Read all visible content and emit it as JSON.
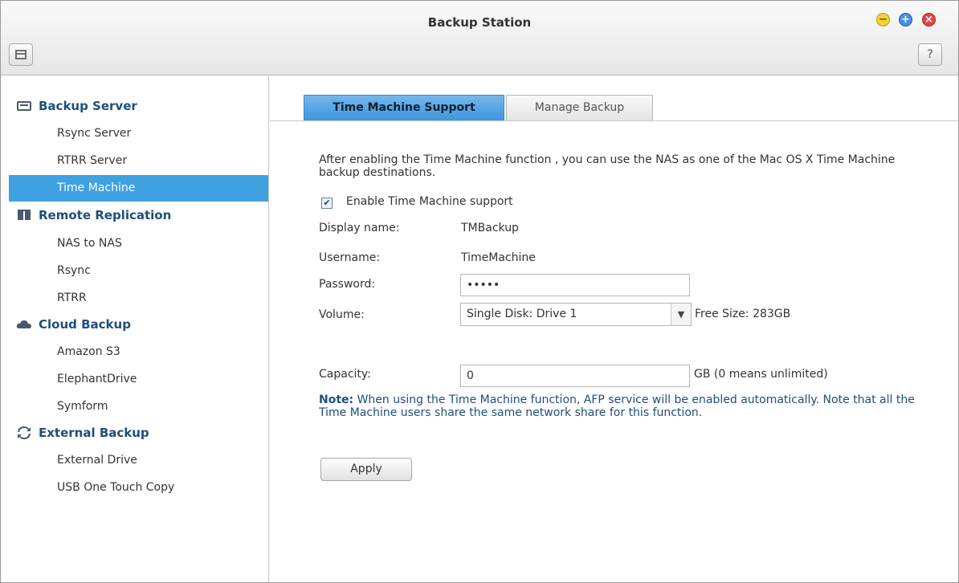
{
  "window": {
    "title": "Backup Station",
    "controls": {
      "minimize": "−",
      "maximize": "+",
      "close": "×"
    },
    "help_label": "?"
  },
  "sidebar": {
    "sections": [
      {
        "title": "Backup Server",
        "icon": "server-icon",
        "items": [
          "Rsync Server",
          "RTRR Server",
          "Time Machine"
        ]
      },
      {
        "title": "Remote Replication",
        "icon": "replication-icon",
        "items": [
          "NAS to NAS",
          "Rsync",
          "RTRR"
        ]
      },
      {
        "title": "Cloud Backup",
        "icon": "cloud-icon",
        "items": [
          "Amazon S3",
          "ElephantDrive",
          "Symform"
        ]
      },
      {
        "title": "External Backup",
        "icon": "sync-icon",
        "items": [
          "External Drive",
          "USB One Touch Copy"
        ]
      }
    ],
    "active_item": "Time Machine"
  },
  "tabs": [
    {
      "label": "Time Machine Support",
      "active": true
    },
    {
      "label": "Manage Backup",
      "active": false
    }
  ],
  "form": {
    "description": "After enabling the Time Machine function , you can use the NAS as one of the Mac OS X Time Machine backup destinations.",
    "enable_label": "Enable Time Machine support",
    "enable_checked": true,
    "display_name_label": "Display name:",
    "display_name_value": "TMBackup",
    "username_label": "Username:",
    "username_value": "TimeMachine",
    "password_label": "Password:",
    "password_value": "•••••",
    "volume_label": "Volume:",
    "volume_value": "Single Disk: Drive  1",
    "free_size": "Free Size: 283GB",
    "capacity_label": "Capacity:",
    "capacity_value": "0",
    "capacity_unit": "GB (0 means unlimited)",
    "note_prefix": "Note:",
    "note_text": " When using the Time Machine function, AFP service will be enabled automatically. Note that all the Time Machine users share the same network share for this function.",
    "apply_label": "Apply"
  },
  "colors": {
    "accent": "#3fa1e0",
    "heading": "#1f4e7a",
    "close": "#e04848",
    "minimize": "#f2d13a",
    "maximize": "#4a8ee0"
  }
}
